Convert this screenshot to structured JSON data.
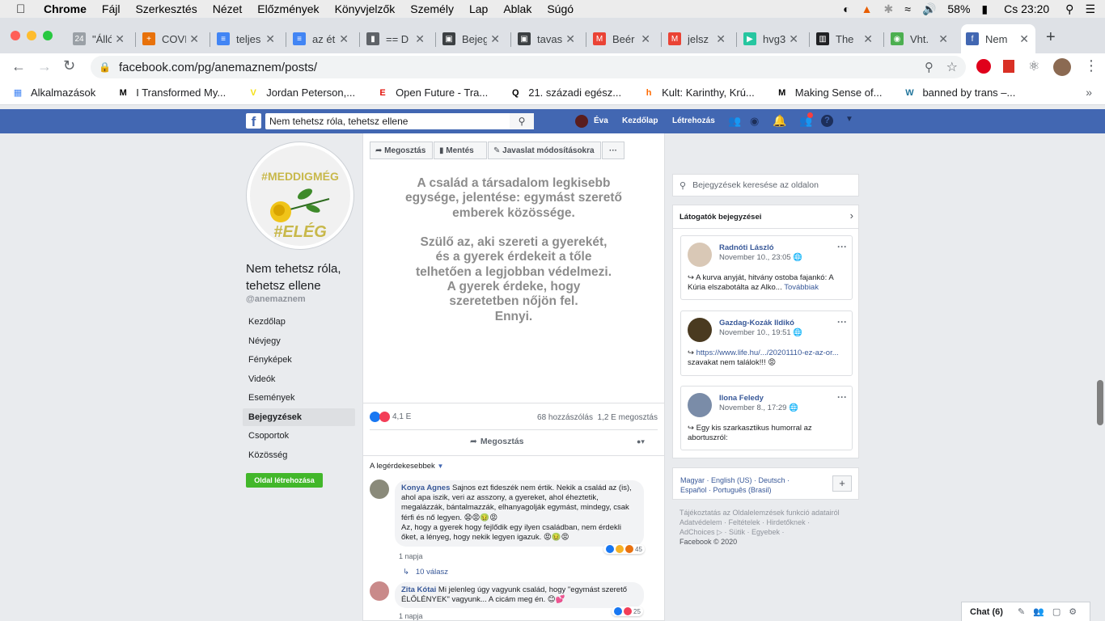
{
  "menubar": {
    "app": "Chrome",
    "items": [
      "Fájl",
      "Szerkesztés",
      "Nézet",
      "Előzmények",
      "Könyvjelzők",
      "Személy",
      "Lap",
      "Ablak",
      "Súgó"
    ],
    "battery": "58%",
    "clock": "Cs 23:20"
  },
  "tabs": [
    {
      "label": "\"Állód",
      "icon": "24-icon"
    },
    {
      "label": "COVI",
      "icon": "medical-icon"
    },
    {
      "label": "teljes",
      "icon": "docs-icon"
    },
    {
      "label": "az ét",
      "icon": "docs-icon"
    },
    {
      "label": "== D",
      "icon": "chart-icon"
    },
    {
      "label": "Bejeg",
      "icon": "photo-icon"
    },
    {
      "label": "tavas",
      "icon": "photo-icon"
    },
    {
      "label": "Beér",
      "icon": "gmail-icon"
    },
    {
      "label": "jelsz",
      "icon": "gmail-icon"
    },
    {
      "label": "hvg3",
      "icon": "hvg-icon"
    },
    {
      "label": "The",
      "icon": "book-icon"
    },
    {
      "label": "Vht.",
      "icon": "globe-icon"
    },
    {
      "label": "Nem",
      "icon": "facebook-icon"
    }
  ],
  "address": {
    "url": "facebook.com/pg/anemaznem/posts/"
  },
  "bookmarks": [
    {
      "label": "Alkalmazások",
      "icon": "apps-icon"
    },
    {
      "label": "I Transformed My...",
      "icon": "medium-icon"
    },
    {
      "label": "Jordan Peterson,...",
      "icon": "vox-icon"
    },
    {
      "label": "Open Future - Tra...",
      "icon": "economist-icon"
    },
    {
      "label": "21. századi egész...",
      "icon": "quora-icon"
    },
    {
      "label": "Kult: Karinthy, Krú...",
      "icon": "hvg-icon"
    },
    {
      "label": "Making Sense of...",
      "icon": "medium-icon"
    },
    {
      "label": "banned by trans –...",
      "icon": "wordpress-icon"
    }
  ],
  "fb": {
    "search_value": "Nem tehetsz róla, tehetsz ellene",
    "user": "Éva",
    "home": "Kezdőlap",
    "create": "Létrehozás"
  },
  "page": {
    "avatar_top": "#MEDDIGMÉG",
    "avatar_bottom": "#ELÉG",
    "name": "Nem tehetsz róla, tehetsz ellene",
    "handle": "@anemaznem",
    "nav": [
      "Kezdőlap",
      "Névjegy",
      "Fényképek",
      "Videók",
      "Események",
      "Bejegyzések",
      "Csoportok",
      "Közösség"
    ],
    "create_page": "Oldal létrehozása"
  },
  "post": {
    "toolbar": [
      "Megosztás",
      "Mentés",
      "Javaslat módosításokra",
      "···"
    ],
    "lines": [
      "A család a társadalom legkisebb",
      "egysége, jelentése: egymást szerető",
      "emberek közössége.",
      "",
      "Szülő az, aki szereti a gyerekét,",
      "és a gyerek érdekeit a tőle",
      "telhetően a legjobban védelmezi.",
      "A gyerek érdeke, hogy",
      "szeretetben nőjön fel.",
      "Ennyi."
    ],
    "reactions": "4,1 E",
    "stats": "68 hozzászólás  1,2 E megosztás",
    "share": "Megosztás",
    "sort": "A legérdekesebbek"
  },
  "comments": [
    {
      "name": "Konya Agnes",
      "text": "Sajnos ezt fideszék nem értik. Nekik a család az (is), ahol apa iszik, veri az asszony, a gyereket, ahol éheztetik, megalázzák, bántalmazzák, elhanyagolják egymást, mindegy, csak férfi és nő legyen. 😧😡🤢😡",
      "text2": "Az, hogy a gyerek hogy fejlődik egy ilyen családban, nem érdekli őket, a lényeg, hogy nekik legyen igazuk. 😡🤢😡",
      "count": "45",
      "time": "1 napja",
      "replies": "10 válasz"
    },
    {
      "name": "Zita Kótai",
      "text": "Mi jelenleg úgy vagyunk család, hogy \"egymást szerető ÉLŐLÉNYEK\" vagyunk... A cicám meg én. 😊💕",
      "count": "25",
      "time": "1 napja"
    }
  ],
  "sidebar": {
    "search_placeholder": "Bejegyzések keresése az oldalon",
    "visitors_title": "Látogatók bejegyzései",
    "posts": [
      {
        "name": "Radnóti László",
        "date": "November 10., 23:05",
        "text": "A kurva anyját, hitvány ostoba fajankó: A Kúria elszabotálta az Alko...",
        "more": "Továbbiak"
      },
      {
        "name": "Gazdag-Kozák Ildikó",
        "date": "November 10., 19:51",
        "text": "https://www.life.hu/.../20201110-ez-az-or...",
        "text2": "szavakat nem találok!!! 😡"
      },
      {
        "name": "Ilona Feledy",
        "date": "November 8., 17:29",
        "text": "Egy kis szarkasztikus humorral az abortuszról:"
      }
    ],
    "langs1": "Magyar · English (US) · Deutsch ·",
    "langs2": "Español · Português (Brasil)",
    "add": "+",
    "footer1": "Tájékoztatás az Oldalelemzések funkció adatairól",
    "footer2": "Adatvédelem · Feltételek · Hirdetőknek ·",
    "footer3": "AdChoices ▷ · Sütik · Egyebek ·",
    "footer4": "Facebook © 2020"
  },
  "chat": {
    "label": "Chat (6)"
  }
}
